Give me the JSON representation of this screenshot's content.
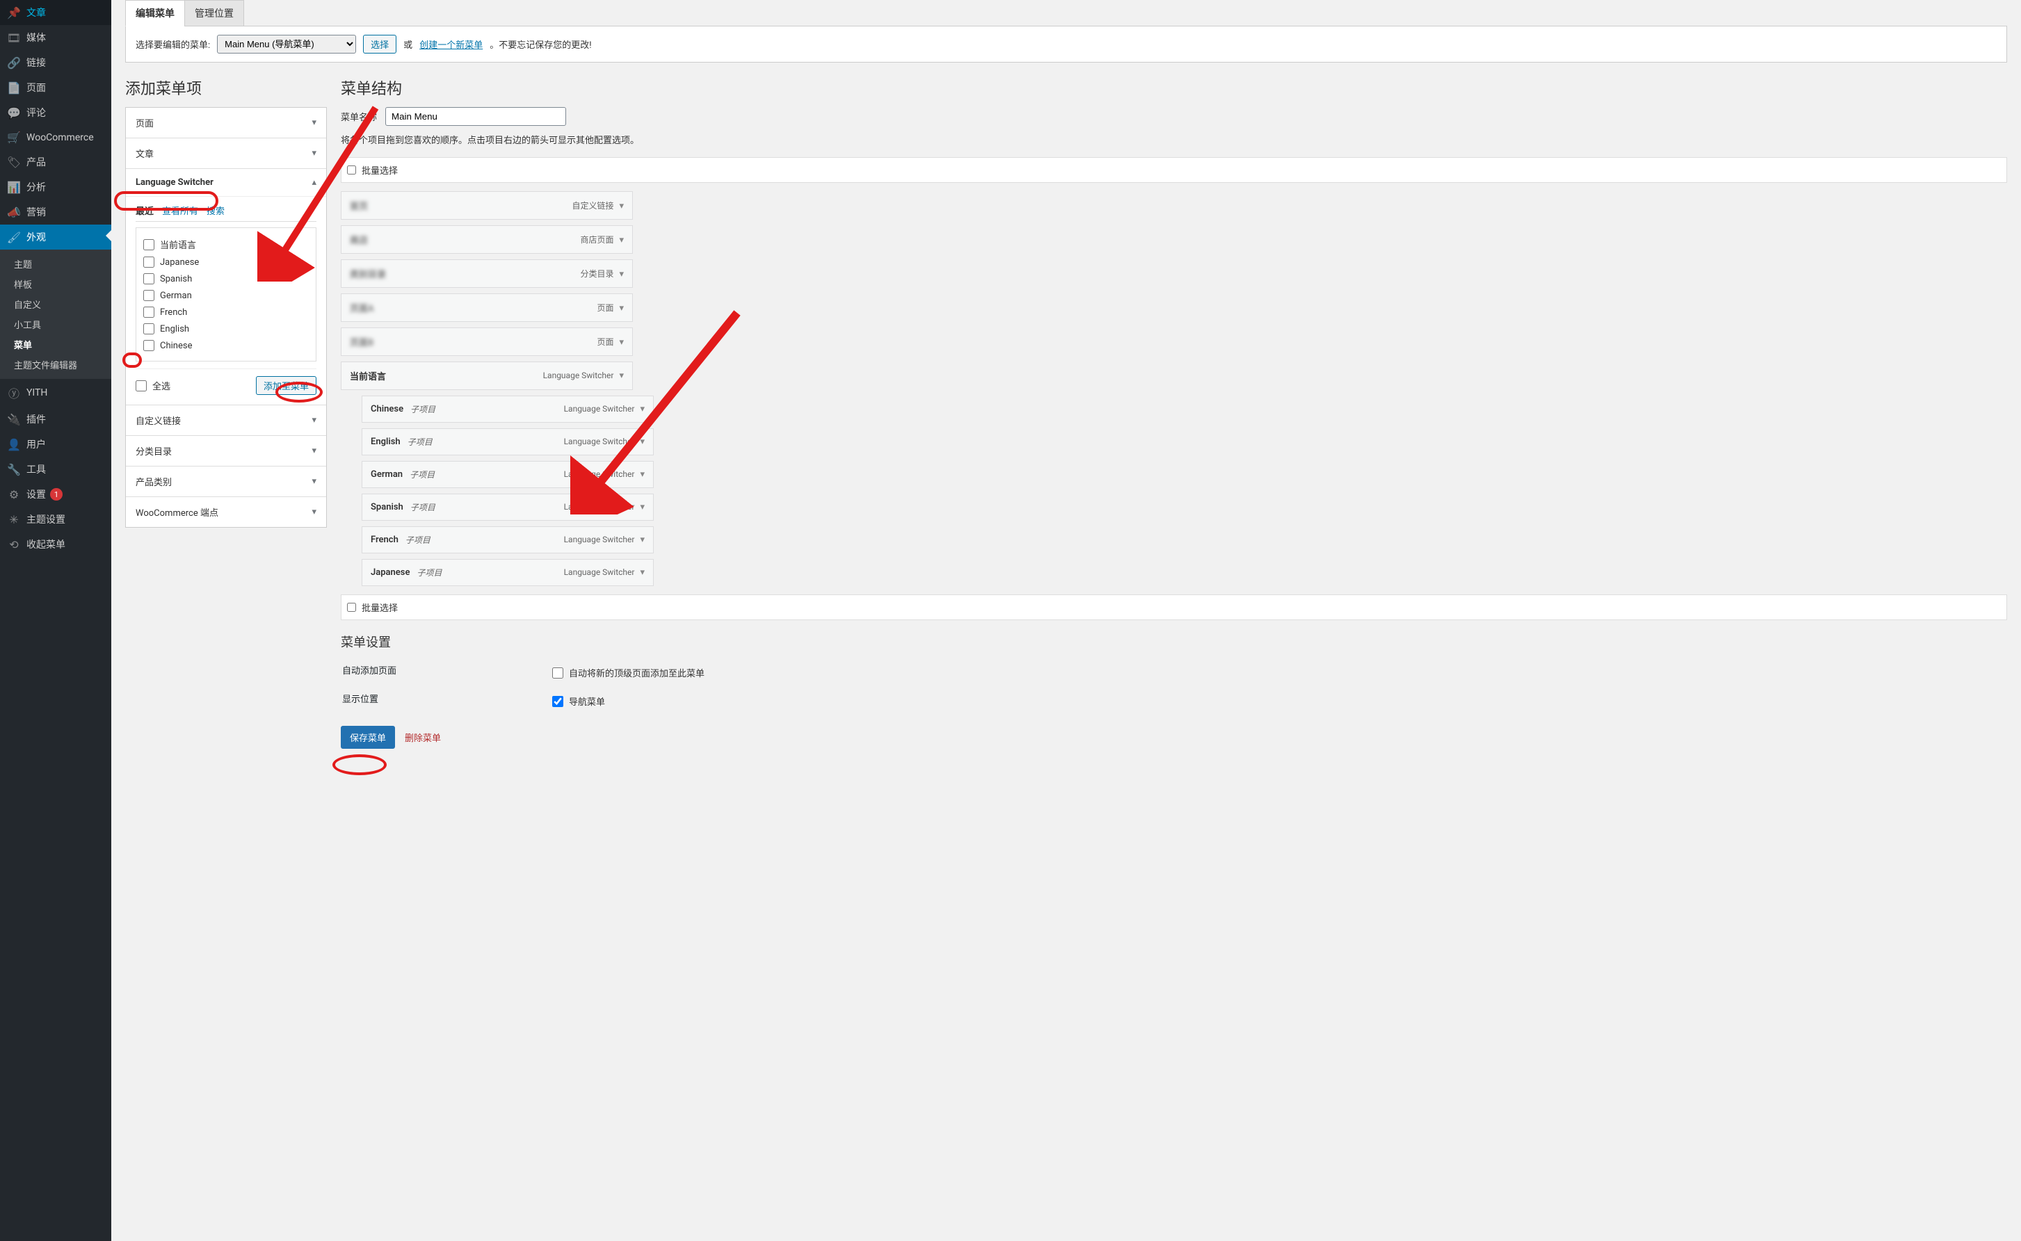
{
  "sidebar": {
    "groups": [
      {
        "icon": "📌",
        "label": "文章"
      },
      {
        "icon": "🎞",
        "label": "媒体"
      },
      {
        "icon": "🔗",
        "label": "链接"
      },
      {
        "icon": "📄",
        "label": "页面"
      },
      {
        "icon": "💬",
        "label": "评论"
      },
      {
        "icon": "🛒",
        "label": "WooCommerce"
      },
      {
        "icon": "🏷",
        "label": "产品"
      },
      {
        "icon": "📊",
        "label": "分析"
      },
      {
        "icon": "📣",
        "label": "营销"
      }
    ],
    "appearance": {
      "icon": "🖌",
      "label": "外观"
    },
    "sub": [
      "主题",
      "样板",
      "自定义",
      "小工具",
      "菜单",
      "主题文件编辑器"
    ],
    "sub_active_index": 4,
    "groups2": [
      {
        "icon": "ⓨ",
        "label": "YITH"
      },
      {
        "icon": "🔌",
        "label": "插件"
      },
      {
        "icon": "👤",
        "label": "用户"
      },
      {
        "icon": "🔧",
        "label": "工具"
      },
      {
        "icon": "⚙",
        "label": "设置",
        "badge": "1"
      },
      {
        "icon": "✳",
        "label": "主题设置"
      },
      {
        "icon": "⟲",
        "label": "收起菜单"
      }
    ]
  },
  "tabs": {
    "edit": "编辑菜单",
    "manage": "管理位置"
  },
  "selector": {
    "label": "选择要编辑的菜单:",
    "options": [
      "Main Menu (导航菜单)"
    ],
    "choose": "选择",
    "or": "或",
    "create_link": "创建一个新菜单",
    "note": "。不要忘记保存您的更改!"
  },
  "left": {
    "heading": "添加菜单项",
    "sections": {
      "page": "页面",
      "post": "文章",
      "lang": "Language Switcher",
      "custom": "自定义链接",
      "cat": "分类目录",
      "prodcat": "产品类别",
      "wc": "WooCommerce 端点"
    },
    "lang_tabs": {
      "recent": "最近",
      "all": "查看所有",
      "search": "搜索"
    },
    "lang_items": [
      "当前语言",
      "Japanese",
      "Spanish",
      "German",
      "French",
      "English",
      "Chinese"
    ],
    "select_all": "全选",
    "add_to_menu": "添加至菜单"
  },
  "right": {
    "heading": "菜单结构",
    "name_label": "菜单名称",
    "name_value": "Main Menu",
    "hint": "将各个项目拖到您喜欢的顺序。点击项目右边的箭头可显示其他配置选项。",
    "bulk": "批量选择",
    "items": [
      {
        "title": "首页",
        "type": "自定义链接",
        "blur": true
      },
      {
        "title": "商店",
        "type": "商店页面",
        "blur": true
      },
      {
        "title": "类别目录",
        "type": "分类目录",
        "blur": true
      },
      {
        "title": "页面A",
        "type": "页面",
        "blur": true
      },
      {
        "title": "页面B",
        "type": "页面",
        "blur": true
      },
      {
        "title": "当前语言",
        "type": "Language Switcher"
      },
      {
        "title": "Chinese",
        "sub": "子项目",
        "type": "Language Switcher",
        "indent": 1
      },
      {
        "title": "English",
        "sub": "子项目",
        "type": "Language Switcher",
        "indent": 1
      },
      {
        "title": "German",
        "sub": "子项目",
        "type": "Language Switcher",
        "indent": 1
      },
      {
        "title": "Spanish",
        "sub": "子项目",
        "type": "Language Switcher",
        "indent": 1
      },
      {
        "title": "French",
        "sub": "子项目",
        "type": "Language Switcher",
        "indent": 1
      },
      {
        "title": "Japanese",
        "sub": "子项目",
        "type": "Language Switcher",
        "indent": 1
      }
    ],
    "bulk2": "批量选择",
    "settings_heading": "菜单设置",
    "auto_add_label": "自动添加页面",
    "auto_add_opt": "自动将新的顶级页面添加至此菜单",
    "display_label": "显示位置",
    "display_opt": "导航菜单",
    "save": "保存菜单",
    "delete": "删除菜单"
  }
}
